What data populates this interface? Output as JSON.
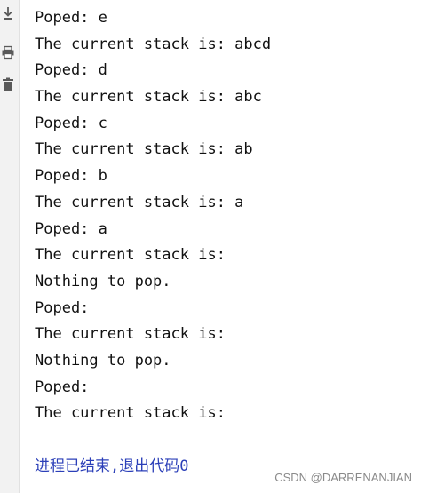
{
  "toolbar": {
    "icons": [
      "scroll-to-end-icon",
      "print-icon",
      "trash-icon"
    ]
  },
  "console": {
    "lines": [
      "Poped: e",
      "The current stack is: abcd",
      "Poped: d",
      "The current stack is: abc",
      "Poped: c",
      "The current stack is: ab",
      "Poped: b",
      "The current stack is: a",
      "Poped: a",
      "The current stack is:",
      "Nothing to pop.",
      "Poped:",
      "The current stack is:",
      "Nothing to pop.",
      "Poped:",
      "The current stack is:"
    ],
    "exit_message": "进程已结束,退出代码0",
    "exit_color": "#2b3fb8"
  },
  "watermark": "CSDN @DARRENANJIAN"
}
